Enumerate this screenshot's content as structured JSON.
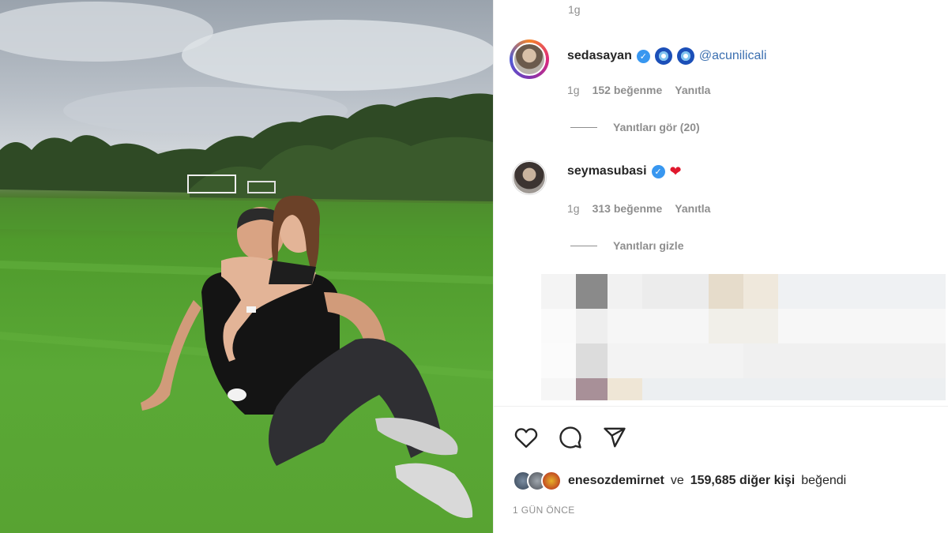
{
  "post": {
    "photo": {
      "description_icon": "photo-image",
      "sky_color": "#b9c0c8",
      "grass_color": "#57a433"
    }
  },
  "comments": {
    "top_time": "1g",
    "items": [
      {
        "username": "sedasayan",
        "verified": true,
        "emojis": [
          "evil-eye-icon",
          "evil-eye-icon"
        ],
        "text": "@acunilicali",
        "time": "1g",
        "likes": "152 beğenme",
        "reply": "Yanıtla",
        "replies_toggle": "Yanıtları gör (20)"
      },
      {
        "username": "seymasubasi",
        "verified": true,
        "text": "❤",
        "time": "1g",
        "likes": "313 beğenme",
        "reply": "Yanıtla",
        "replies_toggle": "Yanıtları gizle"
      }
    ]
  },
  "actions": {
    "like_icon": "heart-outline-icon",
    "comment_icon": "comment-bubble-icon",
    "share_icon": "paper-plane-icon"
  },
  "likes": {
    "user": "enesozdemirnet",
    "connector": "ve",
    "others": "159,685 diğer kişi",
    "suffix": "beğendi"
  },
  "timestamp": "1 GÜN ÖNCE",
  "colors": {
    "verified_blue": "#3897f0",
    "mention_blue": "#3b6fb0",
    "muted_text": "#8e8e8e",
    "heart_red": "#e0182d"
  }
}
